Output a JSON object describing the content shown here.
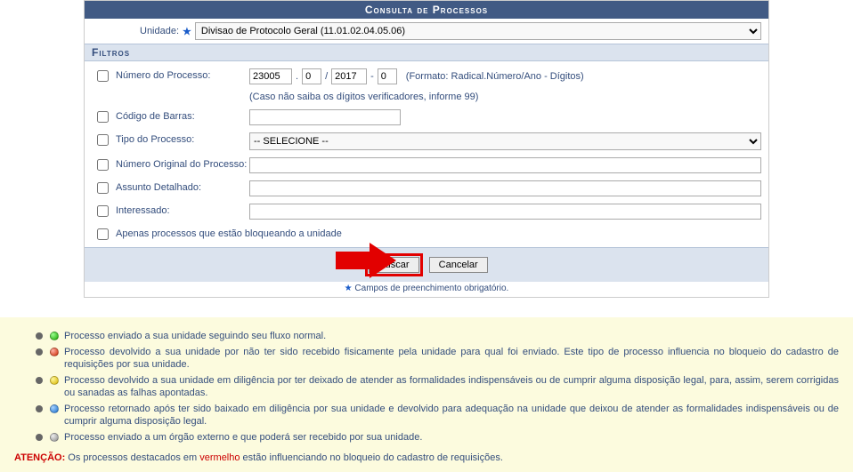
{
  "header": {
    "title": "Consulta de Processos"
  },
  "unidade": {
    "label": "Unidade:",
    "selected": "Divisao de Protocolo Geral (11.01.02.04.05.06)"
  },
  "filtros_header": "Filtros",
  "fields": {
    "numero": {
      "label": "Número do Processo:",
      "radical": "23005",
      "numero": "0",
      "ano": "2017",
      "digitos": "0",
      "dot": ".",
      "slash": "/",
      "dash": "-",
      "formato": "(Formato: Radical.Número/Ano - Dígitos)",
      "hint": "(Caso não saiba os dígitos verificadores, informe 99)"
    },
    "barras": {
      "label": "Código de Barras:",
      "value": ""
    },
    "tipo": {
      "label": "Tipo do Processo:",
      "selected": "-- SELECIONE --"
    },
    "original": {
      "label": "Número Original do Processo:",
      "value": ""
    },
    "assunto": {
      "label": "Assunto Detalhado:",
      "value": ""
    },
    "interessado": {
      "label": "Interessado:",
      "value": ""
    },
    "apenas": {
      "label": "Apenas processos que estão bloqueando a unidade"
    }
  },
  "buttons": {
    "buscar": "Buscar",
    "cancelar": "Cancelar"
  },
  "obrigatorio": {
    "star": "★",
    "text": "Campos de preenchimento obrigatório."
  },
  "legend": {
    "green": "Processo enviado a sua unidade seguindo seu fluxo normal.",
    "red": "Processo devolvido a sua unidade por não ter sido recebido fisicamente pela unidade para qual foi enviado. Este tipo de processo influencia no bloqueio do cadastro de requisições por sua unidade.",
    "yellow": "Processo devolvido a sua unidade em diligência por ter deixado de atender as formalidades indispensáveis ou de cumprir alguma disposição legal, para, assim, serem corrigidas ou sanadas as falhas apontadas.",
    "blue": "Processo retornado após ter sido baixado em diligência por sua unidade e devolvido para adequação na unidade que deixou de atender as formalidades indispensáveis ou de cumprir alguma disposição legal.",
    "gray": "Processo enviado a um órgão externo e que poderá ser recebido por sua unidade."
  },
  "atencao": {
    "label": "ATENÇÃO:",
    "pre": " Os processos destacados em ",
    "vermelho": "vermelho",
    "post": " estão influenciando no bloqueio do cadastro de requisições."
  }
}
